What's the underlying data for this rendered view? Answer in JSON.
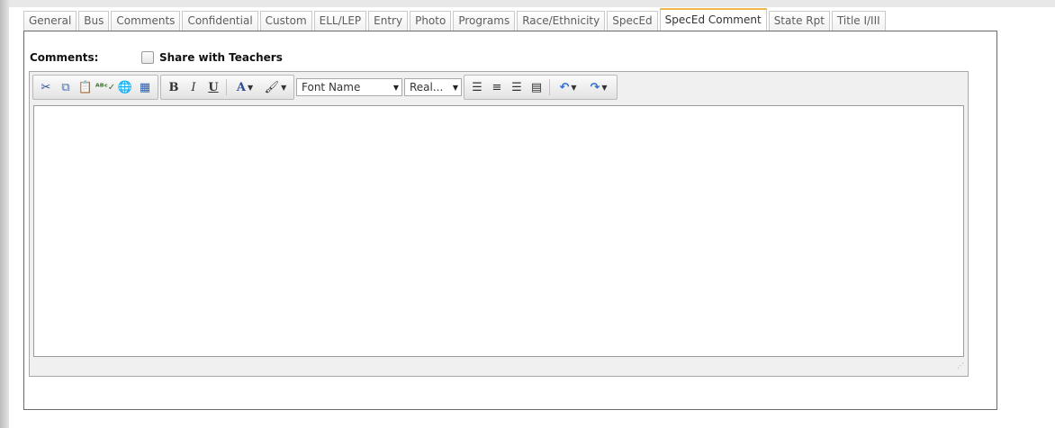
{
  "tabs": [
    {
      "label": "General",
      "active": false
    },
    {
      "label": "Bus",
      "active": false
    },
    {
      "label": "Comments",
      "active": false
    },
    {
      "label": "Confidential",
      "active": false
    },
    {
      "label": "Custom",
      "active": false
    },
    {
      "label": "ELL/LEP",
      "active": false
    },
    {
      "label": "Entry",
      "active": false
    },
    {
      "label": "Photo",
      "active": false
    },
    {
      "label": "Programs",
      "active": false
    },
    {
      "label": "Race/Ethnicity",
      "active": false
    },
    {
      "label": "SpecEd",
      "active": false
    },
    {
      "label": "SpecEd Comment",
      "active": true
    },
    {
      "label": "State Rpt",
      "active": false
    },
    {
      "label": "Title I/III",
      "active": false
    }
  ],
  "form": {
    "comments_label": "Comments:",
    "share_label": "Share with Teachers",
    "share_checked": false
  },
  "toolbar": {
    "font_name": "Font Name",
    "font_size": "Real...",
    "groups": [
      [
        "cut-icon",
        "copy-icon",
        "paste-icon",
        "spellcheck-icon",
        "hyperlink-icon",
        "table-icon"
      ],
      [
        "bold-icon",
        "italic-icon",
        "underline-icon",
        "font-color-icon",
        "highlight-color-icon"
      ],
      [
        "align-left-icon",
        "align-center-icon",
        "align-right-icon",
        "justify-icon",
        "undo-icon",
        "redo-icon"
      ]
    ],
    "accent_color": "#f0b64a"
  }
}
